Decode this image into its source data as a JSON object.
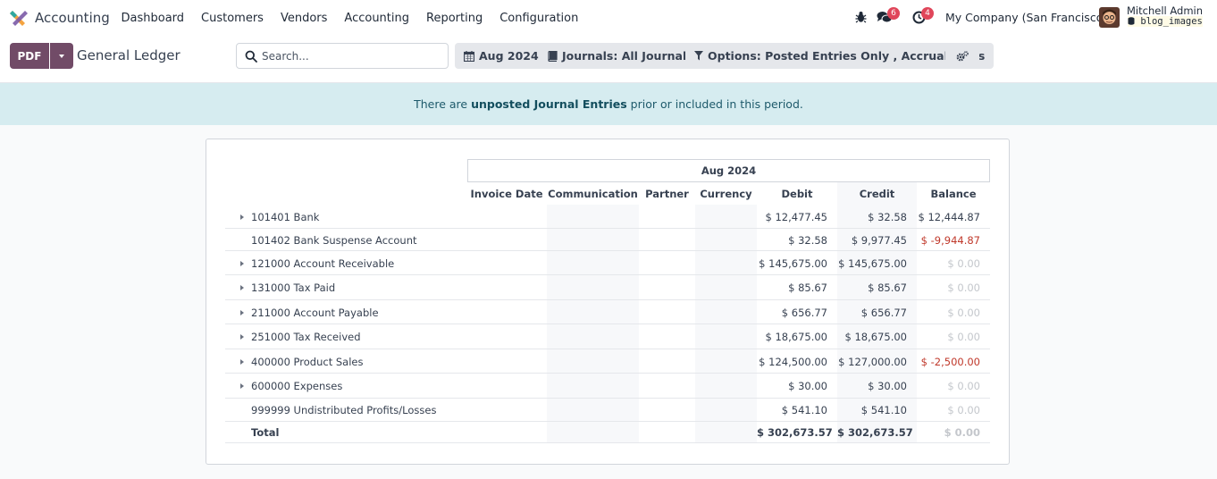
{
  "navbar": {
    "app_name": "Accounting",
    "menu": [
      "Dashboard",
      "Customers",
      "Vendors",
      "Accounting",
      "Reporting",
      "Configuration"
    ],
    "messages_badge": "6",
    "activities_badge": "4",
    "company": "My Company (San Francisco)",
    "user_name": "Mitchell Admin",
    "user_db": "blog_images"
  },
  "control": {
    "pdf_label": "PDF",
    "page_title": "General Ledger",
    "search_placeholder": "Search...",
    "date_filter": "Aug 2024",
    "journals_filter": "Journals: All Journals",
    "options_filter": "Options: Posted Entries Only , Accrual Basis"
  },
  "alert": {
    "prefix": "There are ",
    "link": "unposted Journal Entries",
    "suffix": " prior or included in this period."
  },
  "report": {
    "period": "Aug 2024",
    "columns": [
      "Invoice Date",
      "Communication",
      "Partner",
      "Currency",
      "Debit",
      "Credit",
      "Balance"
    ],
    "rows": [
      {
        "name": "101401 Bank",
        "expandable": true,
        "debit": "$ 12,477.45",
        "credit": "$ 32.58",
        "balance": "$ 12,444.87",
        "balance_state": "normal"
      },
      {
        "name": "101402 Bank Suspense Account",
        "expandable": false,
        "debit": "$ 32.58",
        "credit": "$ 9,977.45",
        "balance": "$ -9,944.87",
        "balance_state": "negative"
      },
      {
        "name": "121000 Account Receivable",
        "expandable": true,
        "debit": "$ 145,675.00",
        "credit": "$ 145,675.00",
        "balance": "$ 0.00",
        "balance_state": "zero"
      },
      {
        "name": "131000 Tax Paid",
        "expandable": true,
        "debit": "$ 85.67",
        "credit": "$ 85.67",
        "balance": "$ 0.00",
        "balance_state": "zero"
      },
      {
        "name": "211000 Account Payable",
        "expandable": true,
        "debit": "$ 656.77",
        "credit": "$ 656.77",
        "balance": "$ 0.00",
        "balance_state": "zero"
      },
      {
        "name": "251000 Tax Received",
        "expandable": true,
        "debit": "$ 18,675.00",
        "credit": "$ 18,675.00",
        "balance": "$ 0.00",
        "balance_state": "zero"
      },
      {
        "name": "400000 Product Sales",
        "expandable": true,
        "debit": "$ 124,500.00",
        "credit": "$ 127,000.00",
        "balance": "$ -2,500.00",
        "balance_state": "negative"
      },
      {
        "name": "600000 Expenses",
        "expandable": true,
        "debit": "$ 30.00",
        "credit": "$ 30.00",
        "balance": "$ 0.00",
        "balance_state": "zero"
      },
      {
        "name": "999999 Undistributed Profits/Losses",
        "expandable": false,
        "debit": "$ 541.10",
        "credit": "$ 541.10",
        "balance": "$ 0.00",
        "balance_state": "zero"
      }
    ],
    "total": {
      "name": "Total",
      "debit": "$ 302,673.57",
      "credit": "$ 302,673.57",
      "balance": "$ 0.00"
    }
  },
  "colors": {
    "brand": "#714b67",
    "alert_bg": "#d6ecf0",
    "negative": "#c0392b",
    "badge": "#e0465a"
  }
}
